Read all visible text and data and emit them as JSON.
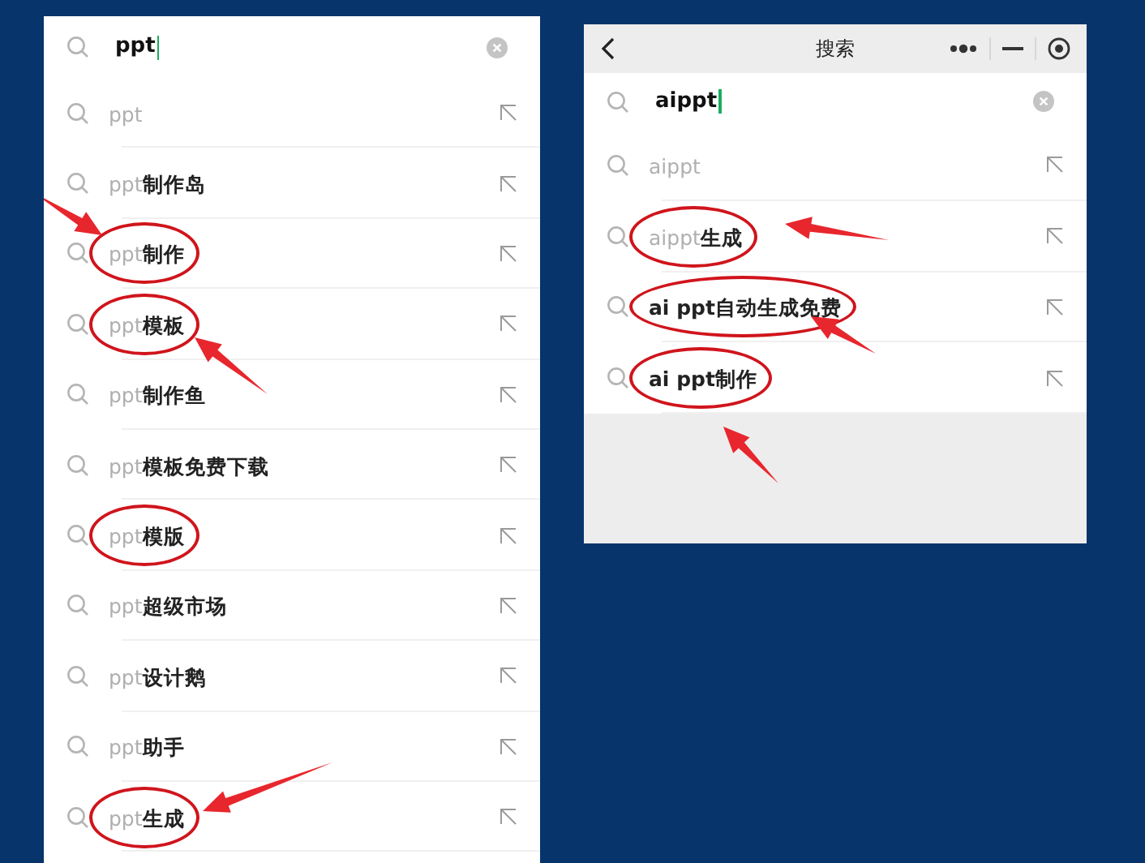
{
  "left_panel": {
    "search": {
      "value": "ppt"
    },
    "suggestions": [
      {
        "matched": "ppt",
        "circled": false,
        "arrow": false
      },
      {
        "matched": "ppt",
        "rest": "制作岛",
        "circled": false,
        "arrow": false
      },
      {
        "matched": "ppt",
        "rest": "制作",
        "circled": true,
        "arrow": true
      },
      {
        "matched": "ppt",
        "rest": "模板",
        "circled": true,
        "arrow": true
      },
      {
        "matched": "ppt",
        "rest": "制作鱼",
        "circled": false,
        "arrow": false
      },
      {
        "matched": "ppt",
        "rest": "模板免费下载",
        "circled": false,
        "arrow": false
      },
      {
        "matched": "ppt",
        "rest": "模版",
        "circled": true,
        "arrow": false
      },
      {
        "matched": "ppt",
        "rest": "超级市场",
        "circled": false,
        "arrow": false
      },
      {
        "matched": "ppt",
        "rest": "设计鹅",
        "circled": false,
        "arrow": false
      },
      {
        "matched": "ppt",
        "rest": "助手",
        "circled": false,
        "arrow": false
      },
      {
        "matched": "ppt",
        "rest": "生成",
        "circled": true,
        "arrow": true
      }
    ]
  },
  "right_panel": {
    "title": "搜索",
    "search": {
      "value": "aippt"
    },
    "suggestions": [
      {
        "matched": "aippt",
        "circled": false,
        "arrow": false
      },
      {
        "matched": "aippt",
        "rest": "生成",
        "circled": true,
        "arrow": true
      },
      {
        "rest": "ai ppt自动生成免费",
        "circled": true,
        "arrow": true
      },
      {
        "rest": "ai ppt制作",
        "circled": true,
        "arrow": true
      }
    ]
  }
}
